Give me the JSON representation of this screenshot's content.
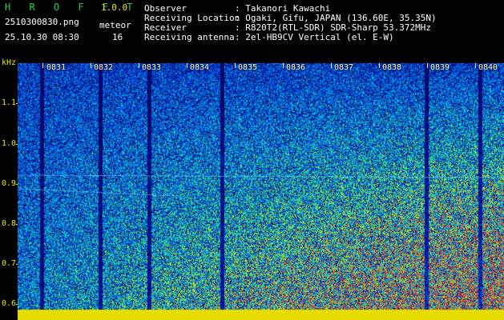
{
  "header": {
    "brand": "H R O F F T",
    "version": "1.0.0",
    "filename": "2510300830.png",
    "datetime": "25.10.30 08:30",
    "meteor_label": "meteor",
    "meteor_count": "16",
    "observer_label": "Observer",
    "observer_value": ": Takanori Kawachi",
    "location_label": "Receiving Location",
    "location_value": ": Ogaki, Gifu, JAPAN (136.60E, 35.35N)",
    "receiver_label": "Receiver",
    "receiver_value": ": R820T2(RTL-SDR) SDR-Sharp 53.372MHz",
    "antenna_label": "Receiving antenna",
    "antenna_value": ": 2el-HB9CV Vertical (el. E-W)"
  },
  "y_axis": {
    "unit": "kHz",
    "ticks": [
      "1.1",
      "1.0",
      "0.9",
      "0.8",
      "0.7",
      "0.6"
    ]
  },
  "x_axis": {
    "ticks": [
      "0831",
      "0832",
      "0833",
      "0834",
      "0835",
      "0836",
      "0837",
      "0838",
      "0839",
      "0840"
    ]
  },
  "colors": {
    "background": "#0a0a6e",
    "yellow": "#e8e800",
    "green": "#20d040"
  }
}
